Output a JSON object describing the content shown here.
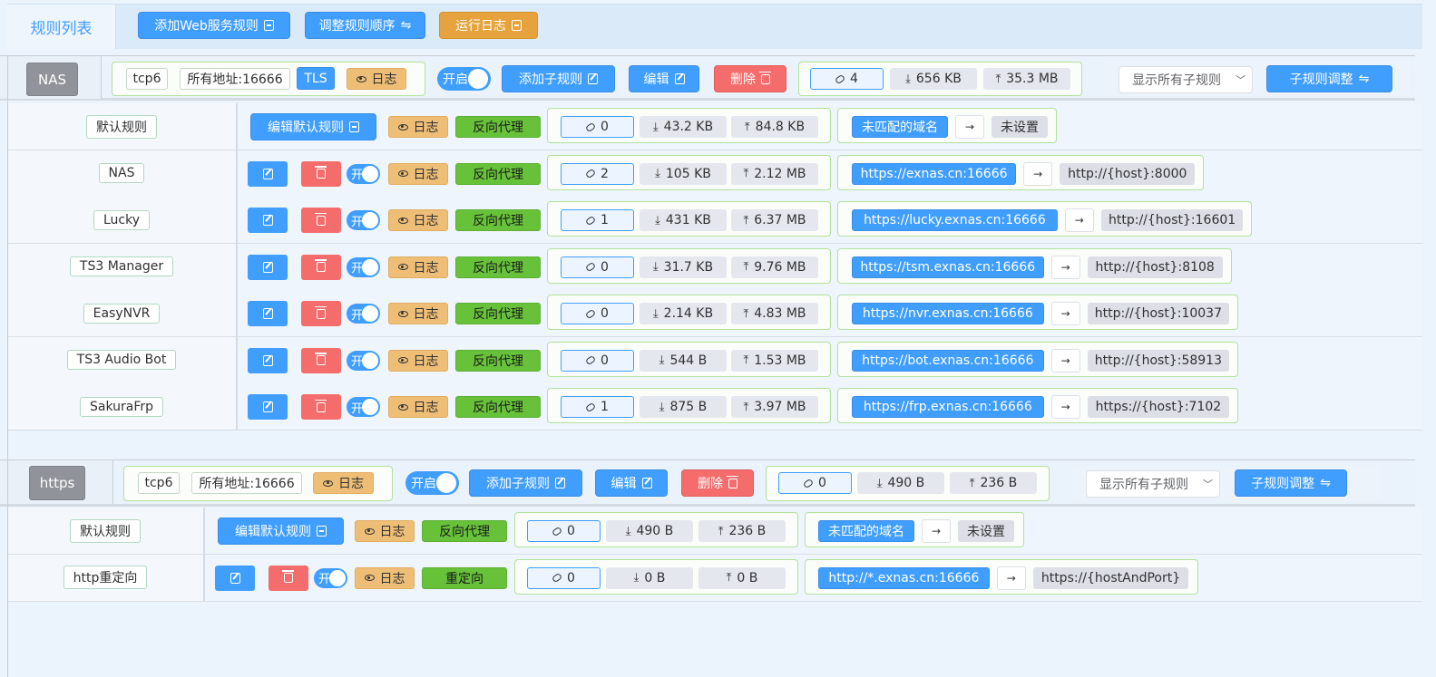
{
  "topbar": {
    "tab_label": "规则列表",
    "add_web_rule": "添加Web服务规则",
    "adjust_order": "调整规则顺序",
    "run_log": "运行日志"
  },
  "common": {
    "log": "日志",
    "toggle_on": "开",
    "toggle_enabled": "开启",
    "add_sub_rule": "添加子规则",
    "edit": "编辑",
    "delete": "删除",
    "edit_default_rule": "编辑默认规则",
    "show_all_sub_rules": "显示所有子规则",
    "sub_rule_adjust": "子规则调整",
    "arrow": "→"
  },
  "sections": [
    {
      "name": "NAS",
      "protocol": "tcp6",
      "address": "所有地址:16666",
      "tls": "TLS",
      "connections": "4",
      "download": "656 KB",
      "upload": "35.3 MB",
      "rules": [
        {
          "label": "默认规则",
          "default": true,
          "type": "反向代理",
          "conn": "0",
          "down": "43.2 KB",
          "up": "84.8 KB",
          "from": "未匹配的域名",
          "to": "未设置"
        },
        {
          "label": "NAS",
          "type": "反向代理",
          "conn": "2",
          "down": "105 KB",
          "up": "2.12 MB",
          "from": "https://exnas.cn:16666",
          "to": "http://{host}:8000"
        },
        {
          "label": "Lucky",
          "type": "反向代理",
          "conn": "1",
          "down": "431 KB",
          "up": "6.37 MB",
          "from": "https://lucky.exnas.cn:16666",
          "to": "http://{host}:16601"
        },
        {
          "label": "TS3 Manager",
          "type": "反向代理",
          "conn": "0",
          "down": "31.7 KB",
          "up": "9.76 MB",
          "from": "https://tsm.exnas.cn:16666",
          "to": "http://{host}:8108"
        },
        {
          "label": "EasyNVR",
          "type": "反向代理",
          "conn": "0",
          "down": "2.14 KB",
          "up": "4.83 MB",
          "from": "https://nvr.exnas.cn:16666",
          "to": "http://{host}:10037"
        },
        {
          "label": "TS3 Audio Bot",
          "type": "反向代理",
          "conn": "0",
          "down": "544 B",
          "up": "1.53 MB",
          "from": "https://bot.exnas.cn:16666",
          "to": "http://{host}:58913"
        },
        {
          "label": "SakuraFrp",
          "type": "反向代理",
          "conn": "1",
          "down": "875 B",
          "up": "3.97 MB",
          "from": "https://frp.exnas.cn:16666",
          "to": "https://{host}:7102"
        }
      ]
    },
    {
      "name": "https",
      "protocol": "tcp6",
      "address": "所有地址:16666",
      "connections": "0",
      "download": "490 B",
      "upload": "236 B",
      "rules": [
        {
          "label": "默认规则",
          "default": true,
          "type": "反向代理",
          "conn": "0",
          "down": "490 B",
          "up": "236 B",
          "from": "未匹配的域名",
          "to": "未设置"
        },
        {
          "label": "http重定向",
          "type": "重定向",
          "conn": "0",
          "down": "0 B",
          "up": "0 B",
          "from": "http://*.exnas.cn:16666",
          "to": "https://{hostAndPort}"
        }
      ]
    }
  ]
}
